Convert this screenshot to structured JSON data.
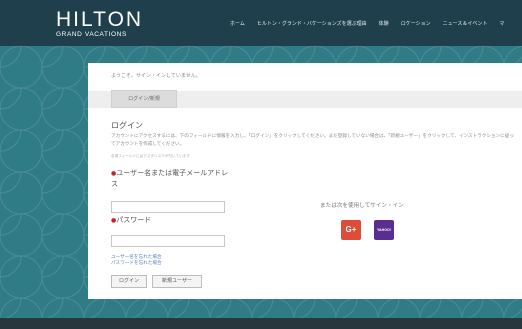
{
  "header": {
    "logo_main": "HILTON",
    "logo_sub": "GRAND VACATIONS",
    "nav": [
      "ホーム",
      "ヒルトン・グランド・バケーションズを選ぶ理由",
      "体験",
      "ロケーション",
      "ニュース＆イベント",
      "マ"
    ]
  },
  "panel": {
    "welcome": "ようこそ。サイン・インしていません。",
    "tab_label": "ログイン/新規",
    "title": "ログイン",
    "instructions": "アカウントにアクセスするには、下のフィールドに情報を入力し、「ログイン」をクリックしてください。まだ登録していない場合は、「新規ユーザー」をクリックして、インストラクションに従ってアカウントを作成してください。",
    "required_note": "必須フィールドにはアスタリスクが付いています",
    "username_label": "ユーザー名または電子メールアドレス",
    "password_label": "パスワード",
    "forgot_username": "ユーザー名を忘れた場合",
    "forgot_password": "パスワードを忘れた場合",
    "login_button": "ログイン",
    "new_user_button": "新規ユーザー",
    "social_label": "または次を使用してサイン・イン",
    "google_label": "G+",
    "yahoo_label": "YAHOO!"
  },
  "colors": {
    "header_bg": "#1f3f4c",
    "background_teal": "#2f7b86",
    "google_red": "#dd4b39",
    "yahoo_purple": "#5b2d90",
    "required_red": "#cc2222"
  }
}
